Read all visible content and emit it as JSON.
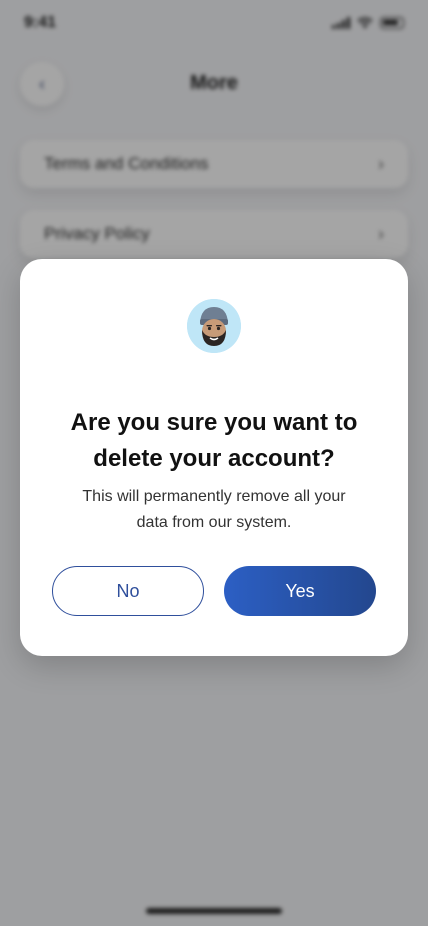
{
  "status_bar": {
    "time": "9:41"
  },
  "header": {
    "title": "More",
    "back_icon": "‹"
  },
  "menu": {
    "items": [
      {
        "label": "Terms and Conditions",
        "chevron": "›"
      },
      {
        "label": "Privacy Policy",
        "chevron": "›"
      }
    ]
  },
  "dialog": {
    "title_line1": "Are you sure you want to",
    "title_line2": "delete your account?",
    "message_line1": "This will permanently remove all your",
    "message_line2": "data from our system.",
    "no_label": "No",
    "yes_label": "Yes"
  },
  "colors": {
    "accent": "#2f4f9c",
    "yes_gradient_start": "#2c5fc4",
    "yes_gradient_end": "#23478e",
    "avatar_bg": "#bfe6f7"
  }
}
